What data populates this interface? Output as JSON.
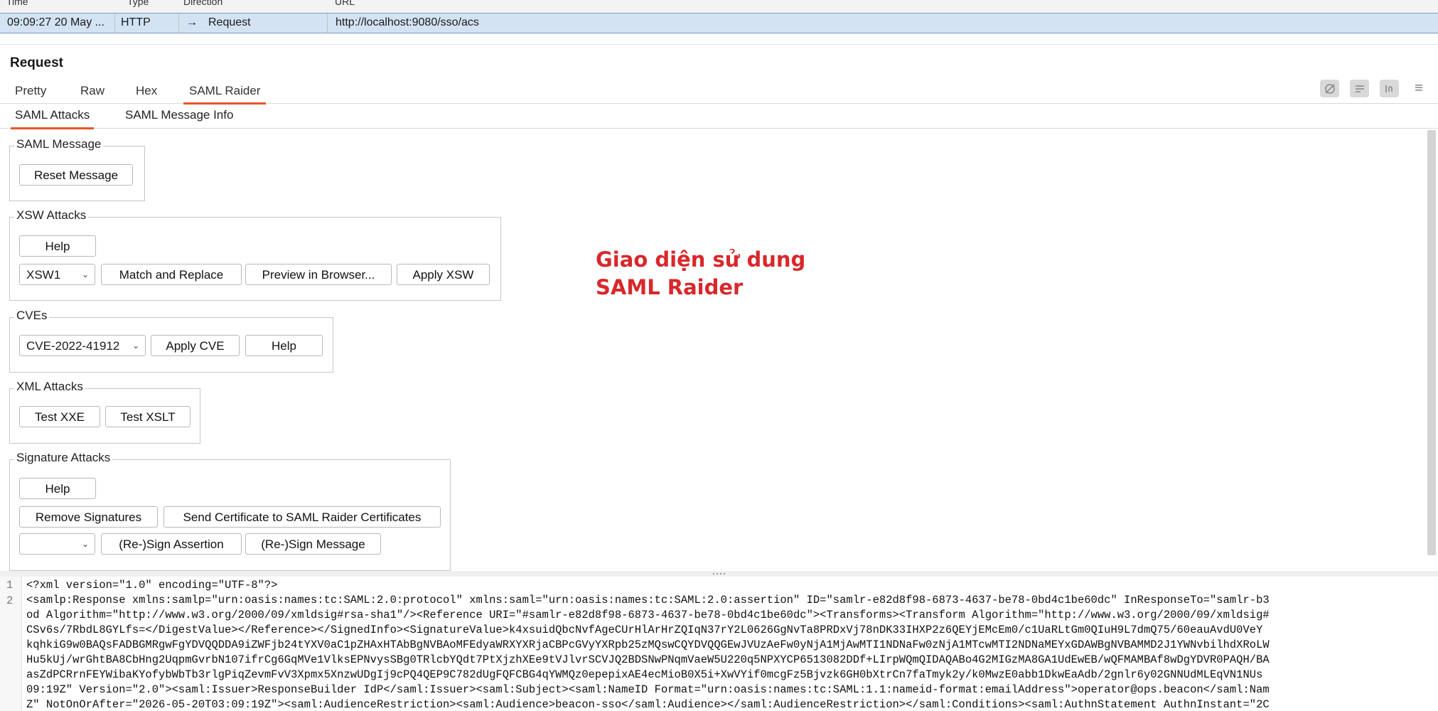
{
  "history": {
    "columns": [
      "Time",
      "Type",
      "Direction",
      "URL"
    ],
    "row": {
      "time": "09:09:27 20 May ...",
      "type": "HTTP",
      "direction_arrow": "→",
      "direction": "Request",
      "url": "http://localhost:9080/sso/acs"
    }
  },
  "request": {
    "title": "Request",
    "tabs": [
      "Pretty",
      "Raw",
      "Hex",
      "SAML Raider"
    ],
    "active_tab": "SAML Raider",
    "toolbar_icons": [
      "eye-off-icon",
      "wrap-lines-icon",
      "newline-icon",
      "menu-icon"
    ]
  },
  "subtabs": [
    "SAML Attacks",
    "SAML Message Info"
  ],
  "saml_message": {
    "legend": "SAML Message",
    "reset": "Reset Message"
  },
  "xsw": {
    "legend": "XSW Attacks",
    "help": "Help",
    "select_value": "XSW1",
    "match_replace": "Match and Replace",
    "preview": "Preview in Browser...",
    "apply": "Apply XSW"
  },
  "cves": {
    "legend": "CVEs",
    "select_value": "CVE-2022-41912",
    "apply": "Apply CVE",
    "help": "Help"
  },
  "xml_attacks": {
    "legend": "XML Attacks",
    "xxe": "Test XXE",
    "xslt": "Test XSLT"
  },
  "signature": {
    "legend": "Signature Attacks",
    "help": "Help",
    "remove": "Remove Signatures",
    "send_cert": "Send Certificate to SAML Raider Certificates",
    "select_value": "",
    "sign_assertion": "(Re-)Sign Assertion",
    "sign_message": "(Re-)Sign Message"
  },
  "annotation": {
    "line1": "Giao diện sử dung",
    "line2": "SAML Raider"
  },
  "editor": {
    "line_numbers": [
      "1",
      "2"
    ],
    "lines": [
      "<?xml version=\"1.0\" encoding=\"UTF-8\"?>",
      "<samlp:Response xmlns:samlp=\"urn:oasis:names:tc:SAML:2.0:protocol\" xmlns:saml=\"urn:oasis:names:tc:SAML:2.0:assertion\" ID=\"samlr-e82d8f98-6873-4637-be78-0bd4c1be60dc\" InResponseTo=\"samlr-b3",
      "od Algorithm=\"http://www.w3.org/2000/09/xmldsig#rsa-sha1\"/><Reference URI=\"#samlr-e82d8f98-6873-4637-be78-0bd4c1be60dc\"><Transforms><Transform Algorithm=\"http://www.w3.org/2000/09/xmldsig#",
      "CSv6s/7RbdL8GYLfs=</DigestValue></Reference></SignedInfo><SignatureValue>k4xsuidQbcNvfAgeCUrHlArHrZQIqN37rY2L0626GgNvTa8PRDxVj78nDK33IHXP2z6QEYjEMcEm0/c1UaRLtGm0QIuH9L7dmQ75/60eauAvdU0VeY",
      "kqhkiG9w0BAQsFADBGMRgwFgYDVQQDDA9iZWFjb24tYXV0aC1pZHAxHTAbBgNVBAoMFEdyaWRXYXRjaCBPcGVyYXRpb25zMQswCQYDVQQGEwJVUzAeFw0yNjA1MjAwMTI1NDNaFw0zNjA1MTcwMTI2NDNaMEYxGDAWBgNVBAMMD2J1YWNvbilhdXRoLW",
      "Hu5kUj/wrGhtBA8CbHng2UqpmGvrbN107ifrCg6GqMVe1VlksEPNvysSBg0TRlcbYQdt7PtXjzhXEe9tVJlvrSCVJQ2BDSNwPNqmVaeW5U220q5NPXYCP6513082DDf+LIrpWQmQIDAQABo4G2MIGzMA8GA1UdEwEB/wQFMAMBAf8wDgYDVR0PAQH/BA",
      "asZdPCRrnFEYWibaKYofybWbTb3rlgPiqZevmFvV3Xpmx5XnzwUDgIj9cPQ4QEP9C782dUgFQFCBG4qYWMQz0epepixAE4ecMioB0X5i+XwVYif0mcgFz5Bjvzk6GH0bXtrCn7faTmyk2y/k0MwzE0abb1DkwEaAdb/2gnlr6y02GNNUdMLEqVN1NUs",
      "09:19Z\" Version=\"2.0\"><saml:Issuer>ResponseBuilder IdP</saml:Issuer><saml:Subject><saml:NameID Format=\"urn:oasis:names:tc:SAML:1.1:nameid-format:emailAddress\">operator@ops.beacon</saml:Nam",
      "Z\" NotOnOrAfter=\"2026-05-20T03:09:19Z\"><saml:AudienceRestriction><saml:Audience>beacon-sso</saml:Audience></saml:AudienceRestriction></saml:Conditions><saml:AuthnStatement AuthnInstant=\"2C"
    ]
  }
}
